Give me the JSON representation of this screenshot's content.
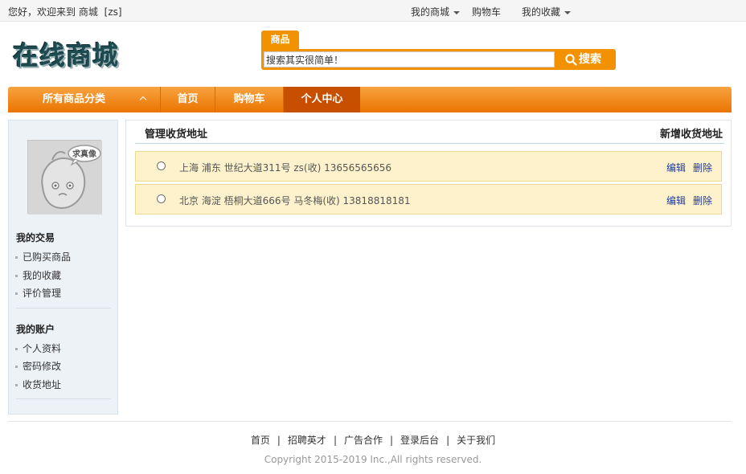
{
  "topbar": {
    "greeting": "您好，欢迎来到 商城",
    "user": "[zs]",
    "my_mall": "我的商城",
    "cart": "购物车",
    "favorites": "我的收藏"
  },
  "header": {
    "logo": "在线商城",
    "search_tab": "商品",
    "search_value": "搜索其实很简单！",
    "search_button": "搜索"
  },
  "nav": {
    "category": "所有商品分类",
    "items": [
      "首页",
      "购物车",
      "个人中心"
    ]
  },
  "sidebar": {
    "avatar_text": "求真像",
    "trade_title": "我的交易",
    "trade_links": [
      "已购买商品",
      "我的收藏",
      "评价管理"
    ],
    "account_title": "我的账户",
    "account_links": [
      "个人资料",
      "密码修改",
      "收货地址"
    ]
  },
  "main": {
    "title": "管理收货地址",
    "add_label": "新增收货地址",
    "addresses": [
      {
        "text": "上海 浦东 世纪大道311号  zs(收)  13656565656",
        "edit": "编辑",
        "delete": "删除"
      },
      {
        "text": "北京 海淀 梧桐大道666号  马冬梅(收)  13818818181",
        "edit": "编辑",
        "delete": "删除"
      }
    ]
  },
  "footer": {
    "links": [
      "首页",
      "招聘英才",
      "广告合作",
      "登录后台",
      "关于我们"
    ],
    "copyright": "Copyright 2015-2019 Inc.,All rights reserved."
  },
  "colors": {
    "accent": "#f39200",
    "nav_active": "#c84e00",
    "address_bg": "#fdf2cc",
    "link": "#1f3b9c"
  }
}
